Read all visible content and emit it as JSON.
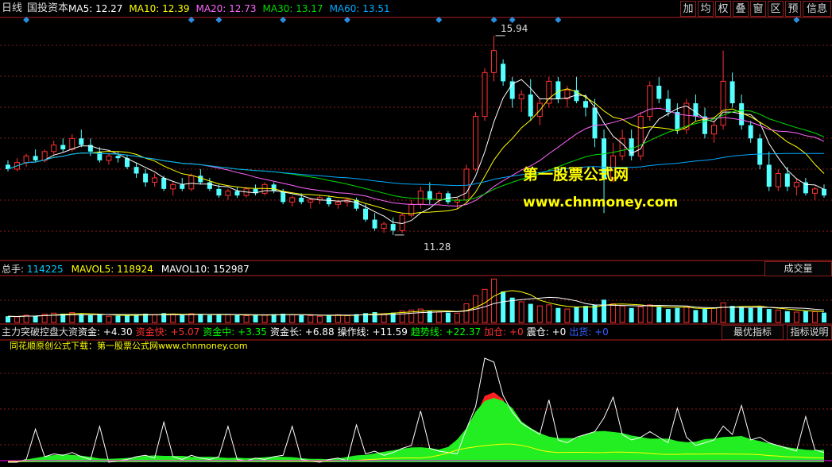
{
  "period_label": "日线",
  "stock_name": "国投资本",
  "ma": [
    {
      "label": "MA5:",
      "value": "12.27",
      "color": "#ffffff"
    },
    {
      "label": "MA10:",
      "value": "12.39",
      "color": "#ffff00"
    },
    {
      "label": "MA20:",
      "value": "12.73",
      "color": "#ff66ff"
    },
    {
      "label": "MA30:",
      "value": "13.17",
      "color": "#00dd00"
    },
    {
      "label": "MA60:",
      "value": "13.51",
      "color": "#00aaff"
    }
  ],
  "toolbar": [
    "加",
    "均",
    "权",
    "叠",
    "窗",
    "区",
    "预",
    "信息"
  ],
  "price_labels": {
    "high": "15.94",
    "low": "11.28"
  },
  "watermark": {
    "line1": "第一股票公式网",
    "line2": "www.chnmoney.com"
  },
  "volume": {
    "items": [
      {
        "label": "总手:",
        "value": "114225",
        "color": "#00ccff"
      },
      {
        "label": "MAVOL5:",
        "value": "118924",
        "color": "#ffff00"
      },
      {
        "label": "MAVOL10:",
        "value": "152987",
        "color": "#ffffff"
      }
    ],
    "button": "成交量"
  },
  "indicator": {
    "title": "主力突破控盘大资",
    "items": [
      {
        "label": "资金:",
        "value": "+4.30",
        "color": "#ffffff"
      },
      {
        "label": "资金快:",
        "value": "+5.07",
        "color": "#ff3030"
      },
      {
        "label": "资金中:",
        "value": "+3.35",
        "color": "#00ff00"
      },
      {
        "label": "资金长:",
        "value": "+6.88",
        "color": "#ffffff"
      },
      {
        "label": "操作线:",
        "value": "+11.59",
        "color": "#ffffff"
      },
      {
        "label": "趋势线:",
        "value": "+22.37",
        "color": "#00ff00"
      },
      {
        "label": "加仓:",
        "value": "+0",
        "color": "#ff3030"
      },
      {
        "label": "震仓:",
        "value": "+0",
        "color": "#ffffff"
      },
      {
        "label": "出货:",
        "value": "+0",
        "color": "#3060ff"
      }
    ],
    "buttons": [
      "最优指标",
      "指标说明"
    ],
    "note": "同花顺原创公式下载：第一股票公式网www.chnmoney.com"
  },
  "colors": {
    "up": "#ff3232",
    "down": "#54ffff",
    "grid": "#8a1a1a",
    "border": "#b02020"
  },
  "chart_data": {
    "type": "candlestick",
    "price_range": [
      11.0,
      16.3
    ],
    "candles": [
      [
        13.0,
        13.1,
        12.85,
        12.9
      ],
      [
        12.9,
        13.15,
        12.85,
        13.05
      ],
      [
        13.05,
        13.25,
        12.95,
        13.2
      ],
      [
        13.2,
        13.35,
        13.05,
        13.1
      ],
      [
        13.1,
        13.35,
        13.05,
        13.3
      ],
      [
        13.3,
        13.55,
        13.2,
        13.45
      ],
      [
        13.45,
        13.6,
        13.3,
        13.35
      ],
      [
        13.35,
        13.7,
        13.3,
        13.6
      ],
      [
        13.6,
        13.8,
        13.4,
        13.45
      ],
      [
        13.45,
        13.6,
        13.2,
        13.3
      ],
      [
        13.3,
        13.4,
        13.05,
        13.1
      ],
      [
        13.1,
        13.25,
        13.0,
        13.2
      ],
      [
        13.2,
        13.3,
        13.05,
        13.15
      ],
      [
        13.15,
        13.2,
        12.9,
        12.95
      ],
      [
        12.95,
        13.05,
        12.7,
        12.8
      ],
      [
        12.8,
        12.9,
        12.5,
        12.6
      ],
      [
        12.6,
        12.8,
        12.5,
        12.7
      ],
      [
        12.7,
        12.75,
        12.4,
        12.45
      ],
      [
        12.45,
        12.6,
        12.3,
        12.55
      ],
      [
        12.55,
        12.7,
        12.4,
        12.45
      ],
      [
        12.45,
        12.8,
        12.4,
        12.75
      ],
      [
        12.75,
        12.9,
        12.55,
        12.6
      ],
      [
        12.6,
        12.7,
        12.4,
        12.45
      ],
      [
        12.45,
        12.55,
        12.25,
        12.3
      ],
      [
        12.3,
        12.45,
        12.2,
        12.4
      ],
      [
        12.4,
        12.5,
        12.25,
        12.3
      ],
      [
        12.3,
        12.5,
        12.25,
        12.45
      ],
      [
        12.45,
        12.55,
        12.3,
        12.35
      ],
      [
        12.35,
        12.6,
        12.3,
        12.55
      ],
      [
        12.55,
        12.6,
        12.35,
        12.4
      ],
      [
        12.4,
        12.45,
        12.1,
        12.15
      ],
      [
        12.15,
        12.3,
        12.05,
        12.25
      ],
      [
        12.25,
        12.35,
        12.1,
        12.15
      ],
      [
        12.15,
        12.25,
        12.0,
        12.2
      ],
      [
        12.2,
        12.3,
        12.1,
        12.25
      ],
      [
        12.25,
        12.3,
        12.05,
        12.1
      ],
      [
        12.1,
        12.2,
        12.0,
        12.15
      ],
      [
        12.15,
        12.25,
        12.05,
        12.2
      ],
      [
        12.2,
        12.25,
        11.95,
        12.0
      ],
      [
        12.0,
        12.1,
        11.7,
        11.75
      ],
      [
        11.75,
        11.9,
        11.5,
        11.55
      ],
      [
        11.55,
        11.7,
        11.45,
        11.65
      ],
      [
        11.65,
        11.8,
        11.4,
        11.5
      ],
      [
        11.5,
        11.9,
        11.45,
        11.85
      ],
      [
        11.85,
        12.2,
        11.8,
        12.1
      ],
      [
        12.1,
        12.5,
        12.0,
        12.4
      ],
      [
        12.4,
        12.6,
        12.1,
        12.2
      ],
      [
        12.2,
        12.4,
        12.1,
        12.35
      ],
      [
        12.35,
        12.4,
        12.1,
        12.15
      ],
      [
        12.15,
        12.25,
        12.0,
        12.2
      ],
      [
        12.2,
        13.0,
        12.15,
        12.9
      ],
      [
        12.9,
        14.2,
        12.85,
        14.1
      ],
      [
        14.1,
        15.2,
        14.0,
        15.1
      ],
      [
        15.1,
        15.94,
        14.9,
        15.6
      ],
      [
        15.3,
        15.4,
        14.8,
        14.9
      ],
      [
        14.9,
        15.0,
        14.3,
        14.5
      ],
      [
        14.5,
        14.7,
        14.2,
        14.6
      ],
      [
        14.6,
        14.95,
        14.0,
        14.1
      ],
      [
        14.1,
        14.5,
        13.9,
        14.4
      ],
      [
        14.4,
        15.0,
        14.3,
        14.9
      ],
      [
        14.9,
        15.0,
        14.4,
        14.5
      ],
      [
        14.5,
        14.8,
        14.3,
        14.7
      ],
      [
        14.7,
        15.0,
        14.4,
        14.45
      ],
      [
        14.45,
        14.6,
        14.1,
        14.3
      ],
      [
        14.3,
        14.5,
        13.4,
        13.6
      ],
      [
        13.6,
        13.8,
        11.9,
        12.7
      ],
      [
        12.7,
        13.5,
        12.6,
        13.2
      ],
      [
        13.2,
        13.8,
        13.1,
        13.6
      ],
      [
        13.6,
        13.8,
        13.1,
        13.2
      ],
      [
        13.2,
        14.2,
        13.1,
        14.1
      ],
      [
        14.1,
        14.9,
        14.0,
        14.8
      ],
      [
        14.8,
        15.0,
        14.4,
        14.5
      ],
      [
        14.5,
        14.7,
        14.1,
        14.2
      ],
      [
        14.2,
        14.4,
        13.7,
        13.8
      ],
      [
        13.8,
        14.5,
        13.7,
        14.4
      ],
      [
        14.4,
        14.6,
        14.0,
        14.1
      ],
      [
        14.1,
        14.3,
        13.6,
        13.7
      ],
      [
        13.7,
        14.0,
        13.5,
        13.9
      ],
      [
        13.9,
        15.6,
        13.8,
        14.9
      ],
      [
        14.9,
        15.1,
        14.3,
        14.4
      ],
      [
        14.4,
        14.6,
        13.8,
        13.9
      ],
      [
        13.9,
        14.0,
        13.5,
        13.6
      ],
      [
        13.6,
        13.7,
        12.9,
        13.0
      ],
      [
        13.0,
        13.3,
        12.4,
        12.5
      ],
      [
        12.5,
        12.9,
        12.4,
        12.8
      ],
      [
        12.8,
        12.95,
        12.4,
        12.5
      ],
      [
        12.5,
        12.7,
        12.3,
        12.6
      ],
      [
        12.6,
        12.7,
        12.3,
        12.35
      ],
      [
        12.35,
        12.5,
        12.2,
        12.45
      ],
      [
        12.45,
        12.55,
        12.25,
        12.3
      ]
    ],
    "volume_range": [
      0,
      430000
    ],
    "volumes": [
      60,
      55,
      70,
      65,
      80,
      90,
      85,
      95,
      80,
      70,
      75,
      60,
      65,
      70,
      80,
      85,
      75,
      90,
      80,
      70,
      85,
      75,
      70,
      80,
      75,
      70,
      65,
      75,
      70,
      80,
      85,
      75,
      70,
      65,
      60,
      70,
      75,
      65,
      80,
      90,
      100,
      85,
      95,
      110,
      120,
      130,
      110,
      100,
      95,
      90,
      180,
      260,
      320,
      420,
      300,
      240,
      200,
      180,
      160,
      170,
      140,
      130,
      150,
      160,
      170,
      220,
      180,
      160,
      140,
      150,
      170,
      150,
      130,
      140,
      150,
      120,
      130,
      140,
      190,
      160,
      150,
      140,
      150,
      130,
      120,
      110,
      100,
      110,
      105,
      95
    ]
  }
}
